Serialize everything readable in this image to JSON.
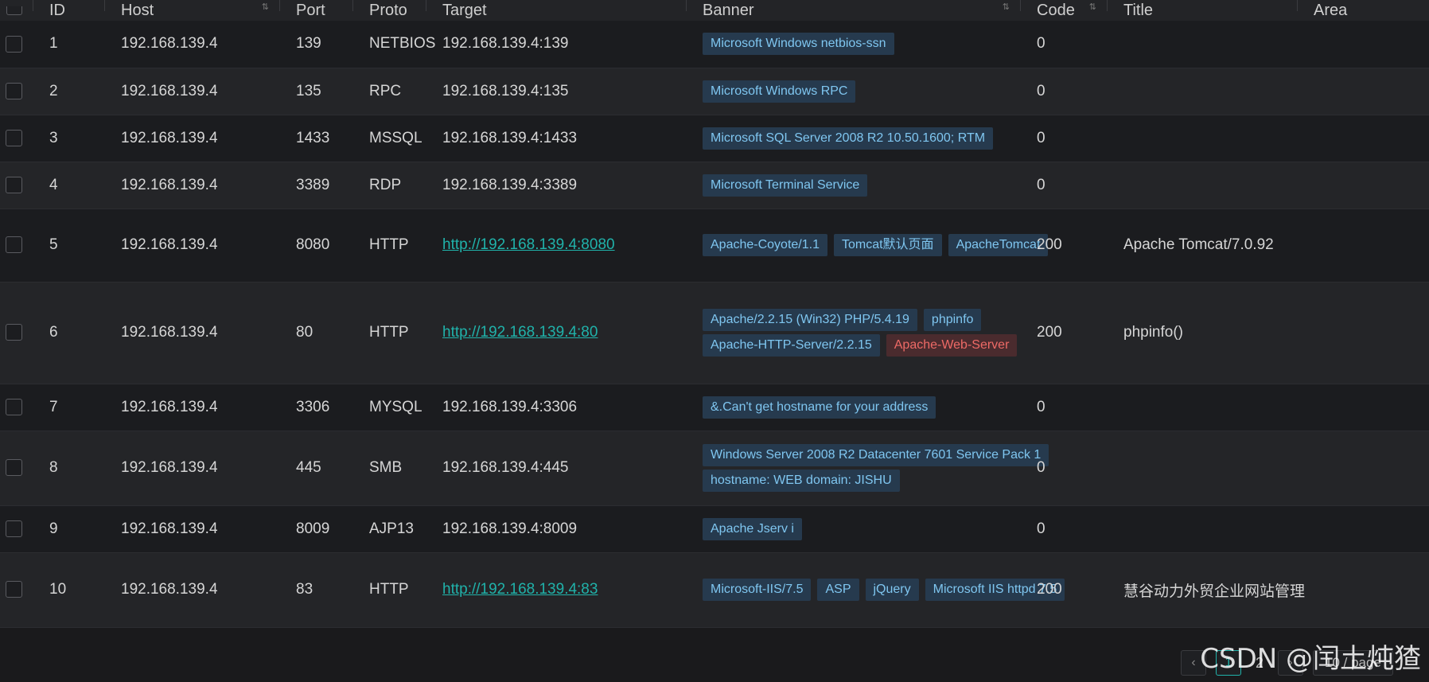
{
  "columns": [
    "ID",
    "Host",
    "Port",
    "Proto",
    "Target",
    "Banner",
    "Code",
    "Title",
    "Area"
  ],
  "rows": [
    {
      "id": "1",
      "host": "192.168.139.4",
      "port": "139",
      "proto": "NETBIOS",
      "target": "192.168.139.4:139",
      "target_is_link": false,
      "banners": [
        {
          "text": "Microsoft Windows netbios-ssn"
        }
      ],
      "code": "0",
      "title": ""
    },
    {
      "id": "2",
      "host": "192.168.139.4",
      "port": "135",
      "proto": "RPC",
      "target": "192.168.139.4:135",
      "target_is_link": false,
      "banners": [
        {
          "text": "Microsoft Windows RPC"
        }
      ],
      "code": "0",
      "title": ""
    },
    {
      "id": "3",
      "host": "192.168.139.4",
      "port": "1433",
      "proto": "MSSQL",
      "target": "192.168.139.4:1433",
      "target_is_link": false,
      "banners": [
        {
          "text": "Microsoft SQL Server 2008 R2 10.50.1600; RTM"
        }
      ],
      "code": "0",
      "title": ""
    },
    {
      "id": "4",
      "host": "192.168.139.4",
      "port": "3389",
      "proto": "RDP",
      "target": "192.168.139.4:3389",
      "target_is_link": false,
      "banners": [
        {
          "text": "Microsoft Terminal Service"
        }
      ],
      "code": "0",
      "title": ""
    },
    {
      "id": "5",
      "host": "192.168.139.4",
      "port": "8080",
      "proto": "HTTP",
      "target": "http://192.168.139.4:8080",
      "target_is_link": true,
      "banners": [
        {
          "text": "Apache-Coyote/1.1"
        },
        {
          "text": "Tomcat默认页面"
        },
        {
          "text": "ApacheTomcat"
        }
      ],
      "code": "200",
      "title": "Apache Tomcat/7.0.92"
    },
    {
      "id": "6",
      "host": "192.168.139.4",
      "port": "80",
      "proto": "HTTP",
      "target": "http://192.168.139.4:80",
      "target_is_link": true,
      "banners": [
        {
          "text": "Apache/2.2.15 (Win32) PHP/5.4.19"
        },
        {
          "text": "phpinfo"
        },
        {
          "text": "Apache-HTTP-Server/2.2.15"
        },
        {
          "text": "Apache-Web-Server",
          "color": "red"
        }
      ],
      "code": "200",
      "title": "phpinfo()"
    },
    {
      "id": "7",
      "host": "192.168.139.4",
      "port": "3306",
      "proto": "MYSQL",
      "target": "192.168.139.4:3306",
      "target_is_link": false,
      "banners": [
        {
          "text": "&.Can't get hostname for your address"
        }
      ],
      "code": "0",
      "title": ""
    },
    {
      "id": "8",
      "host": "192.168.139.4",
      "port": "445",
      "proto": "SMB",
      "target": "192.168.139.4:445",
      "target_is_link": false,
      "banners": [
        {
          "text": "Windows Server 2008 R2 Datacenter 7601 Service Pack 1"
        },
        {
          "text": "hostname: WEB domain: JISHU"
        }
      ],
      "code": "0",
      "title": ""
    },
    {
      "id": "9",
      "host": "192.168.139.4",
      "port": "8009",
      "proto": "AJP13",
      "target": "192.168.139.4:8009",
      "target_is_link": false,
      "banners": [
        {
          "text": "Apache Jserv i"
        }
      ],
      "code": "0",
      "title": ""
    },
    {
      "id": "10",
      "host": "192.168.139.4",
      "port": "83",
      "proto": "HTTP",
      "target": "http://192.168.139.4:83",
      "target_is_link": true,
      "banners": [
        {
          "text": "Microsoft-IIS/7.5"
        },
        {
          "text": "ASP"
        },
        {
          "text": "jQuery"
        },
        {
          "text": "Microsoft IIS httpd 7.5"
        }
      ],
      "code": "200",
      "title": "慧谷动力外贸企业网站管理"
    }
  ],
  "pagination": {
    "prev_icon": "chevron-left-icon",
    "current_page": "1",
    "next_page": "2",
    "next_icon": "chevron-right-icon",
    "page_size": "10 / page"
  },
  "watermark": "CSDN @闰土炖猹",
  "colors": {
    "background": "#1a1a1c",
    "link": "#20b2aa",
    "tag_bg": "#263a4e",
    "tag_text": "#7fc6f0",
    "tag_red_bg": "#4a2b2e",
    "tag_red_text": "#ee6a66"
  }
}
